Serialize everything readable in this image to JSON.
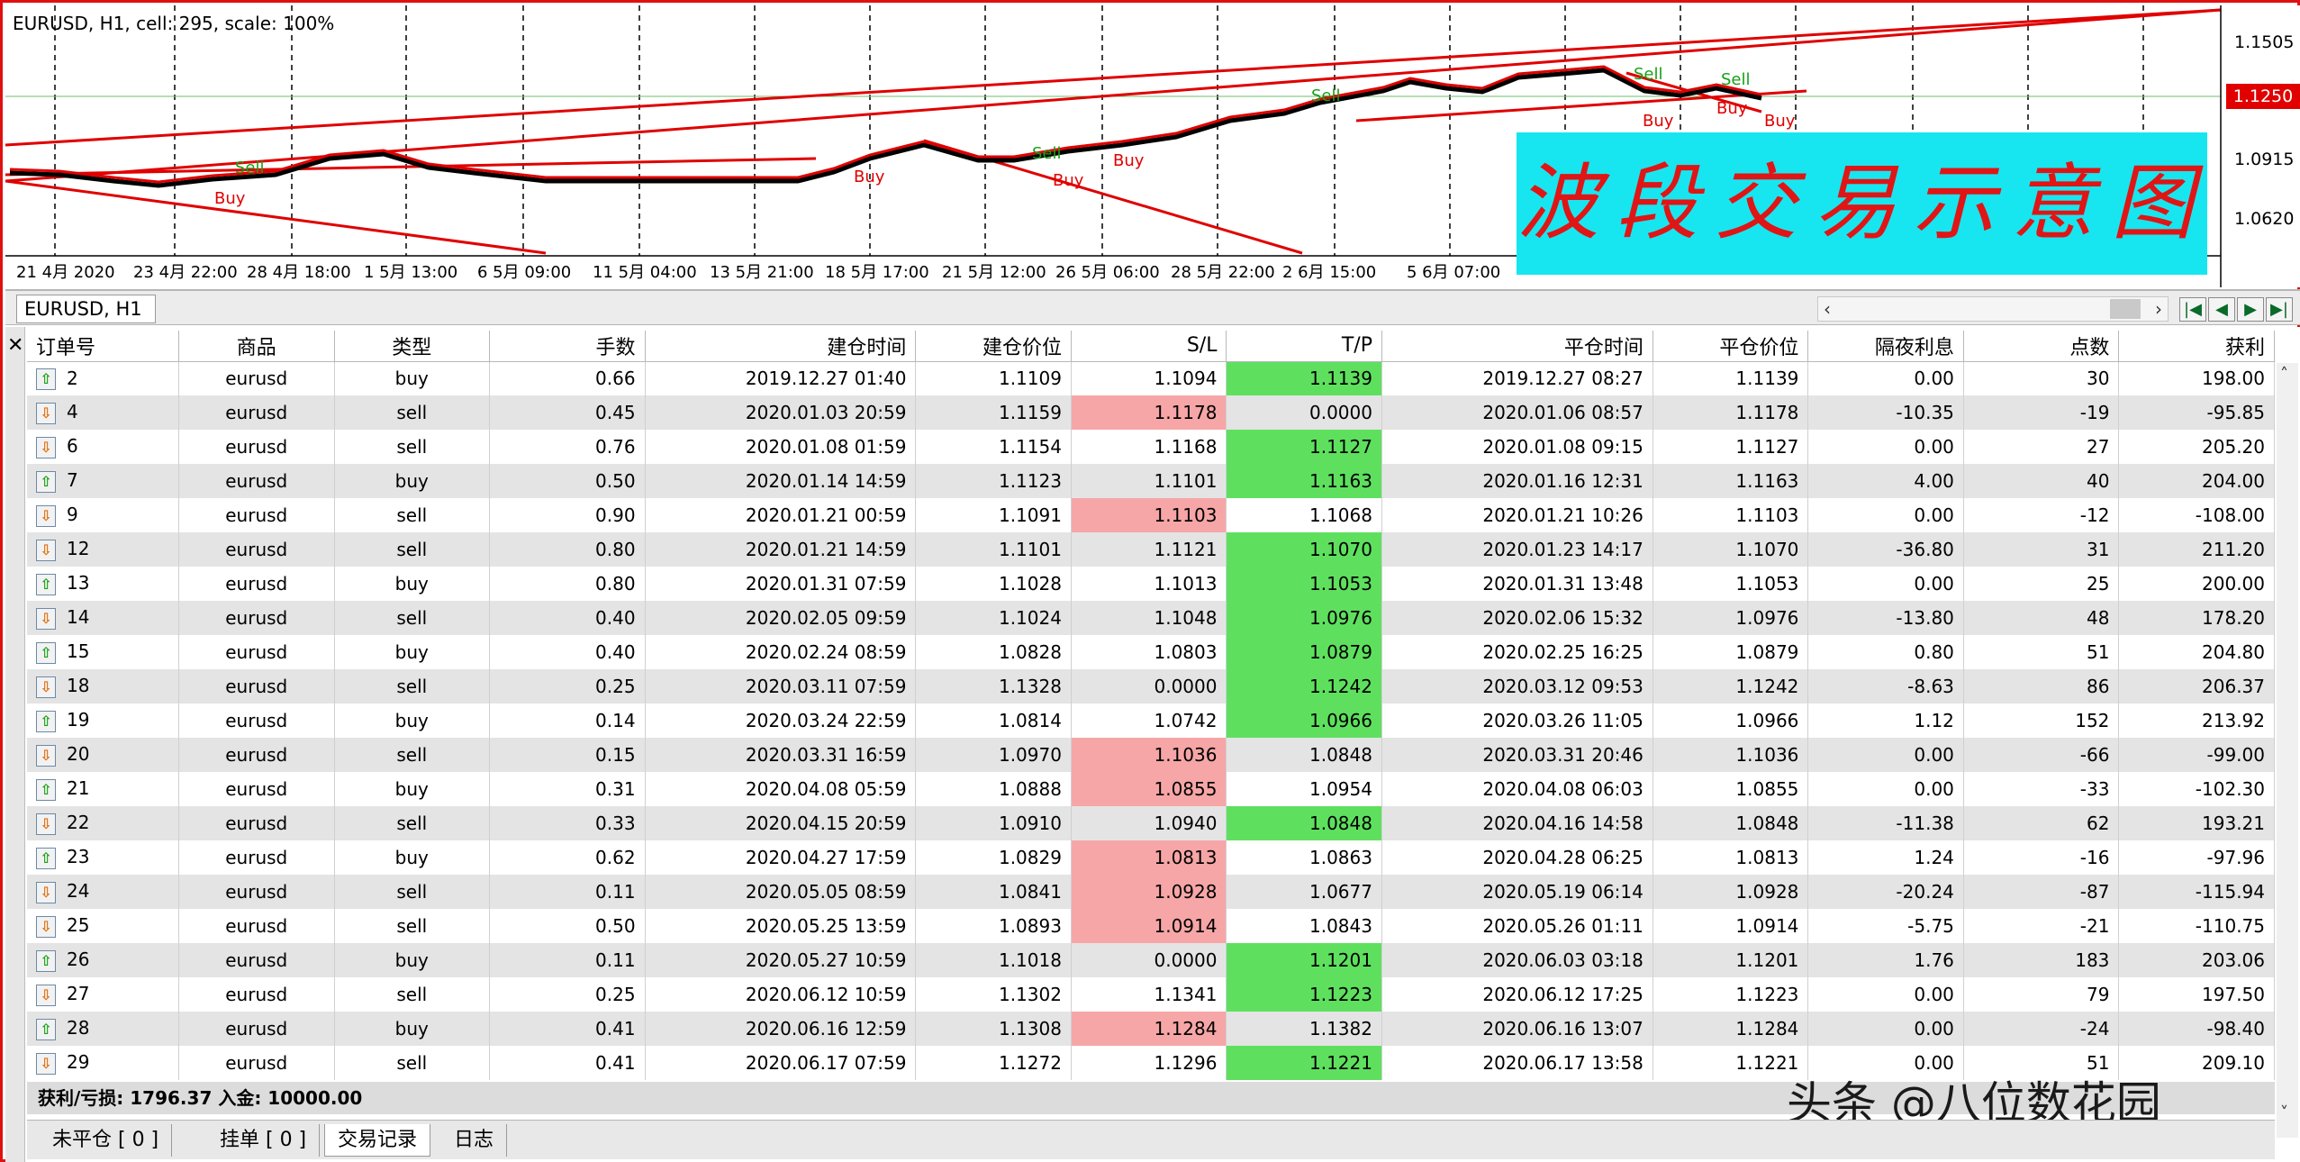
{
  "chart": {
    "title": "EURUSD, H1, cell: 295, scale: 100%",
    "overlay_text": "波段交易示意图",
    "price_axis": [
      "1.1505",
      "1.0915",
      "1.0620"
    ],
    "current_price": "1.1250",
    "time_axis": [
      "21 4月 2020",
      "23 4月 22:00",
      "28 4月 18:00",
      "1 5月 13:00",
      "6 5月 09:00",
      "11 5月 04:00",
      "13 5月 21:00",
      "18 5月 17:00",
      "21 5月 12:00",
      "26 5月 06:00",
      "28 5月 22:00",
      "2 6月 15:00",
      "5 6月 07:00"
    ],
    "markers": {
      "buy": "Buy",
      "sell": "Sell"
    },
    "colors": {
      "trend_line": "#e00000",
      "price": "#000000",
      "marker_buy": "#e00000",
      "marker_sell": "#18a018"
    }
  },
  "symbol_tab": "EURUSD, H1",
  "table": {
    "headers": [
      "订单号",
      "商品",
      "类型",
      "手数",
      "建仓时间",
      "建仓价位",
      "S/L",
      "T/P",
      "平仓时间",
      "平仓价位",
      "隔夜利息",
      "点数",
      "获利"
    ],
    "rows": [
      {
        "order": "2",
        "symbol": "eurusd",
        "type": "buy",
        "lots": "0.66",
        "open_time": "2019.12.27 01:40",
        "open_price": "1.1109",
        "sl": "1.1094",
        "tp": "1.1139",
        "close_time": "2019.12.27 08:27",
        "close_price": "1.1139",
        "swap": "0.00",
        "points": "30",
        "profit": "198.00",
        "hit": "tp"
      },
      {
        "order": "4",
        "symbol": "eurusd",
        "type": "sell",
        "lots": "0.45",
        "open_time": "2020.01.03 20:59",
        "open_price": "1.1159",
        "sl": "1.1178",
        "tp": "0.0000",
        "close_time": "2020.01.06 08:57",
        "close_price": "1.1178",
        "swap": "-10.35",
        "points": "-19",
        "profit": "-95.85",
        "hit": "sl"
      },
      {
        "order": "6",
        "symbol": "eurusd",
        "type": "sell",
        "lots": "0.76",
        "open_time": "2020.01.08 01:59",
        "open_price": "1.1154",
        "sl": "1.1168",
        "tp": "1.1127",
        "close_time": "2020.01.08 09:15",
        "close_price": "1.1127",
        "swap": "0.00",
        "points": "27",
        "profit": "205.20",
        "hit": "tp"
      },
      {
        "order": "7",
        "symbol": "eurusd",
        "type": "buy",
        "lots": "0.50",
        "open_time": "2020.01.14 14:59",
        "open_price": "1.1123",
        "sl": "1.1101",
        "tp": "1.1163",
        "close_time": "2020.01.16 12:31",
        "close_price": "1.1163",
        "swap": "4.00",
        "points": "40",
        "profit": "204.00",
        "hit": "tp"
      },
      {
        "order": "9",
        "symbol": "eurusd",
        "type": "sell",
        "lots": "0.90",
        "open_time": "2020.01.21 00:59",
        "open_price": "1.1091",
        "sl": "1.1103",
        "tp": "1.1068",
        "close_time": "2020.01.21 10:26",
        "close_price": "1.1103",
        "swap": "0.00",
        "points": "-12",
        "profit": "-108.00",
        "hit": "sl"
      },
      {
        "order": "12",
        "symbol": "eurusd",
        "type": "sell",
        "lots": "0.80",
        "open_time": "2020.01.21 14:59",
        "open_price": "1.1101",
        "sl": "1.1121",
        "tp": "1.1070",
        "close_time": "2020.01.23 14:17",
        "close_price": "1.1070",
        "swap": "-36.80",
        "points": "31",
        "profit": "211.20",
        "hit": "tp"
      },
      {
        "order": "13",
        "symbol": "eurusd",
        "type": "buy",
        "lots": "0.80",
        "open_time": "2020.01.31 07:59",
        "open_price": "1.1028",
        "sl": "1.1013",
        "tp": "1.1053",
        "close_time": "2020.01.31 13:48",
        "close_price": "1.1053",
        "swap": "0.00",
        "points": "25",
        "profit": "200.00",
        "hit": "tp"
      },
      {
        "order": "14",
        "symbol": "eurusd",
        "type": "sell",
        "lots": "0.40",
        "open_time": "2020.02.05 09:59",
        "open_price": "1.1024",
        "sl": "1.1048",
        "tp": "1.0976",
        "close_time": "2020.02.06 15:32",
        "close_price": "1.0976",
        "swap": "-13.80",
        "points": "48",
        "profit": "178.20",
        "hit": "tp"
      },
      {
        "order": "15",
        "symbol": "eurusd",
        "type": "buy",
        "lots": "0.40",
        "open_time": "2020.02.24 08:59",
        "open_price": "1.0828",
        "sl": "1.0803",
        "tp": "1.0879",
        "close_time": "2020.02.25 16:25",
        "close_price": "1.0879",
        "swap": "0.80",
        "points": "51",
        "profit": "204.80",
        "hit": "tp"
      },
      {
        "order": "18",
        "symbol": "eurusd",
        "type": "sell",
        "lots": "0.25",
        "open_time": "2020.03.11 07:59",
        "open_price": "1.1328",
        "sl": "0.0000",
        "tp": "1.1242",
        "close_time": "2020.03.12 09:53",
        "close_price": "1.1242",
        "swap": "-8.63",
        "points": "86",
        "profit": "206.37",
        "hit": "tp"
      },
      {
        "order": "19",
        "symbol": "eurusd",
        "type": "buy",
        "lots": "0.14",
        "open_time": "2020.03.24 22:59",
        "open_price": "1.0814",
        "sl": "1.0742",
        "tp": "1.0966",
        "close_time": "2020.03.26 11:05",
        "close_price": "1.0966",
        "swap": "1.12",
        "points": "152",
        "profit": "213.92",
        "hit": "tp"
      },
      {
        "order": "20",
        "symbol": "eurusd",
        "type": "sell",
        "lots": "0.15",
        "open_time": "2020.03.31 16:59",
        "open_price": "1.0970",
        "sl": "1.1036",
        "tp": "1.0848",
        "close_time": "2020.03.31 20:46",
        "close_price": "1.1036",
        "swap": "0.00",
        "points": "-66",
        "profit": "-99.00",
        "hit": "sl"
      },
      {
        "order": "21",
        "symbol": "eurusd",
        "type": "buy",
        "lots": "0.31",
        "open_time": "2020.04.08 05:59",
        "open_price": "1.0888",
        "sl": "1.0855",
        "tp": "1.0954",
        "close_time": "2020.04.08 06:03",
        "close_price": "1.0855",
        "swap": "0.00",
        "points": "-33",
        "profit": "-102.30",
        "hit": "sl"
      },
      {
        "order": "22",
        "symbol": "eurusd",
        "type": "sell",
        "lots": "0.33",
        "open_time": "2020.04.15 20:59",
        "open_price": "1.0910",
        "sl": "1.0940",
        "tp": "1.0848",
        "close_time": "2020.04.16 14:58",
        "close_price": "1.0848",
        "swap": "-11.38",
        "points": "62",
        "profit": "193.21",
        "hit": "tp"
      },
      {
        "order": "23",
        "symbol": "eurusd",
        "type": "buy",
        "lots": "0.62",
        "open_time": "2020.04.27 17:59",
        "open_price": "1.0829",
        "sl": "1.0813",
        "tp": "1.0863",
        "close_time": "2020.04.28 06:25",
        "close_price": "1.0813",
        "swap": "1.24",
        "points": "-16",
        "profit": "-97.96",
        "hit": "sl"
      },
      {
        "order": "24",
        "symbol": "eurusd",
        "type": "sell",
        "lots": "0.11",
        "open_time": "2020.05.05 08:59",
        "open_price": "1.0841",
        "sl": "1.0928",
        "tp": "1.0677",
        "close_time": "2020.05.19 06:14",
        "close_price": "1.0928",
        "swap": "-20.24",
        "points": "-87",
        "profit": "-115.94",
        "hit": "sl"
      },
      {
        "order": "25",
        "symbol": "eurusd",
        "type": "sell",
        "lots": "0.50",
        "open_time": "2020.05.25 13:59",
        "open_price": "1.0893",
        "sl": "1.0914",
        "tp": "1.0843",
        "close_time": "2020.05.26 01:11",
        "close_price": "1.0914",
        "swap": "-5.75",
        "points": "-21",
        "profit": "-110.75",
        "hit": "sl"
      },
      {
        "order": "26",
        "symbol": "eurusd",
        "type": "buy",
        "lots": "0.11",
        "open_time": "2020.05.27 10:59",
        "open_price": "1.1018",
        "sl": "0.0000",
        "tp": "1.1201",
        "close_time": "2020.06.03 03:18",
        "close_price": "1.1201",
        "swap": "1.76",
        "points": "183",
        "profit": "203.06",
        "hit": "tp"
      },
      {
        "order": "27",
        "symbol": "eurusd",
        "type": "sell",
        "lots": "0.25",
        "open_time": "2020.06.12 10:59",
        "open_price": "1.1302",
        "sl": "1.1341",
        "tp": "1.1223",
        "close_time": "2020.06.12 17:25",
        "close_price": "1.1223",
        "swap": "0.00",
        "points": "79",
        "profit": "197.50",
        "hit": "tp"
      },
      {
        "order": "28",
        "symbol": "eurusd",
        "type": "buy",
        "lots": "0.41",
        "open_time": "2020.06.16 12:59",
        "open_price": "1.1308",
        "sl": "1.1284",
        "tp": "1.1382",
        "close_time": "2020.06.16 13:07",
        "close_price": "1.1284",
        "swap": "0.00",
        "points": "-24",
        "profit": "-98.40",
        "hit": "sl"
      },
      {
        "order": "29",
        "symbol": "eurusd",
        "type": "sell",
        "lots": "0.41",
        "open_time": "2020.06.17 07:59",
        "open_price": "1.1272",
        "sl": "1.1296",
        "tp": "1.1221",
        "close_time": "2020.06.17 13:58",
        "close_price": "1.1221",
        "swap": "0.00",
        "points": "51",
        "profit": "209.10",
        "hit": "tp"
      }
    ]
  },
  "summary": "获利/亏损: 1796.37  入金: 10000.00",
  "watermark": "头条 @八位数花园",
  "bottom_tabs": [
    "未平仓 [ 0 ]",
    "挂单 [ 0 ]",
    "交易记录",
    "日志"
  ],
  "active_tab": "交易记录",
  "colors": {
    "sl_hit": "#f6a6a6",
    "tp_hit": "#5ee05e",
    "frame": "#e01010",
    "overlay_bg": "#17e6f0",
    "overlay_text": "#e01515"
  }
}
